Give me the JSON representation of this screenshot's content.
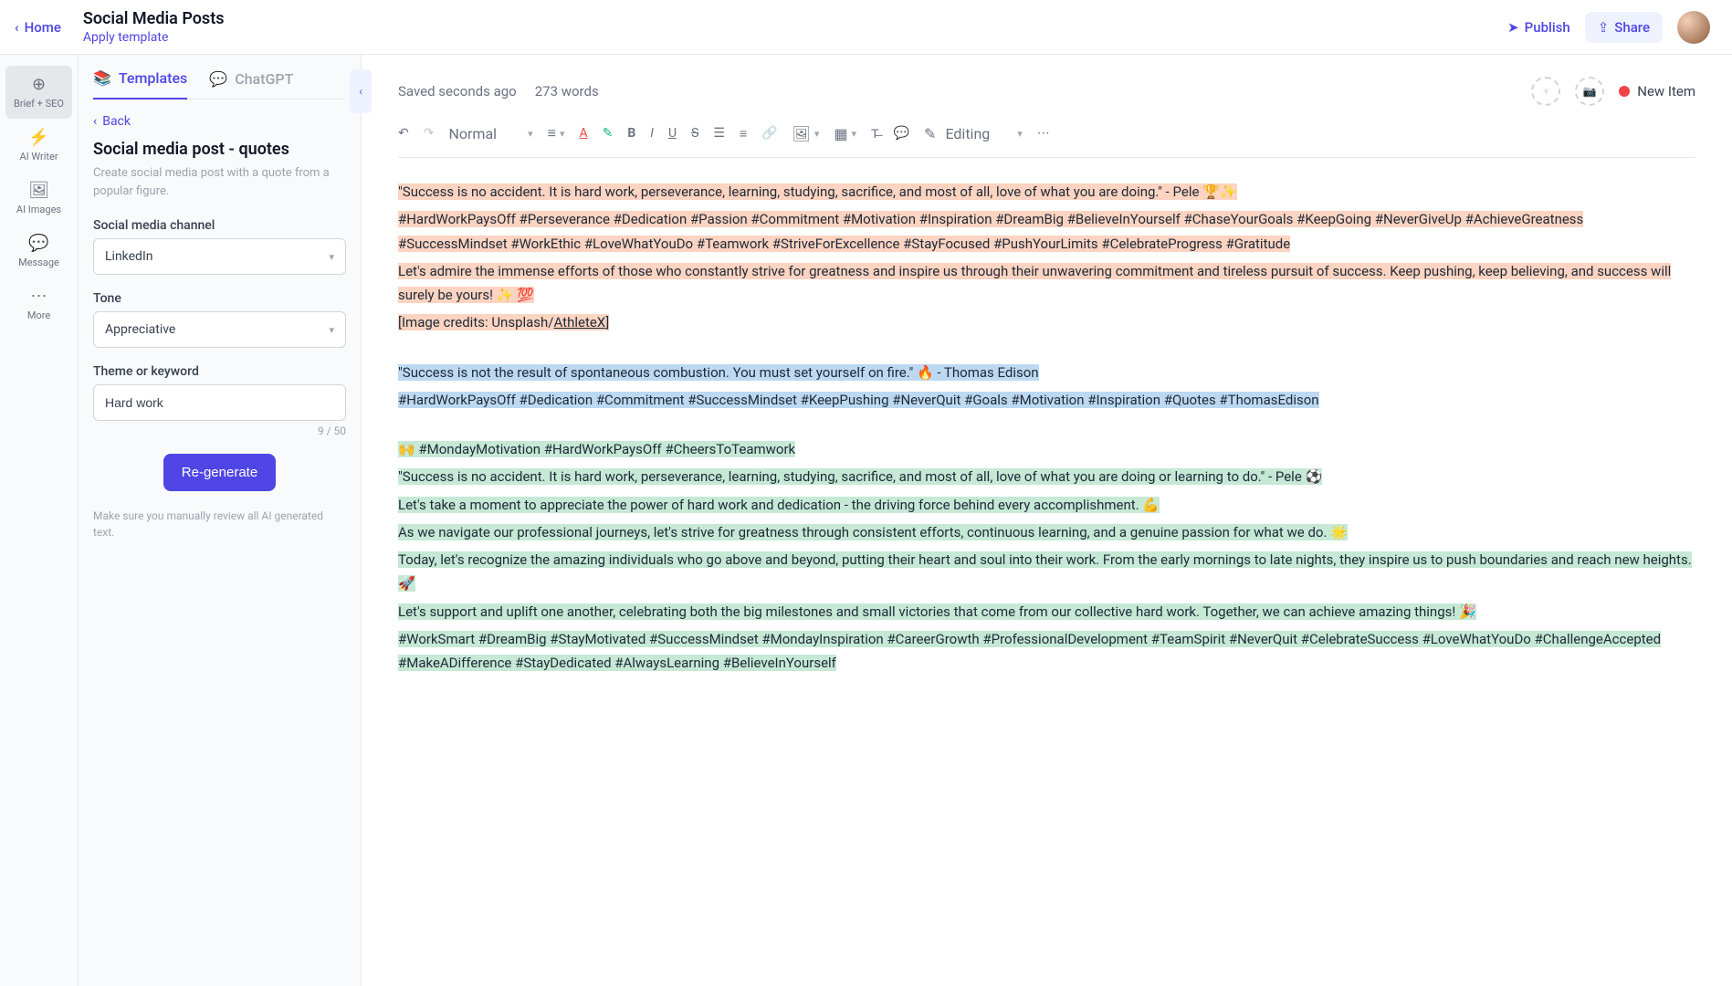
{
  "header": {
    "home": "Home",
    "title": "Social Media Posts",
    "apply_template": "Apply template",
    "publish": "Publish",
    "share": "Share"
  },
  "rail": {
    "brief": "Brief + SEO",
    "writer": "AI Writer",
    "images": "AI Images",
    "message": "Message",
    "more": "More"
  },
  "panel": {
    "tab_templates": "Templates",
    "tab_chatgpt": "ChatGPT",
    "back": "Back",
    "template_title": "Social media post - quotes",
    "template_desc": "Create social media post with a quote from a popular figure.",
    "channel_label": "Social media channel",
    "channel_value": "LinkedIn",
    "tone_label": "Tone",
    "tone_value": "Appreciative",
    "theme_label": "Theme or keyword",
    "theme_value": "Hard work",
    "char_count": "9 / 50",
    "regenerate": "Re-generate",
    "review_note": "Make sure you manually review all AI generated text."
  },
  "editor": {
    "saved": "Saved seconds ago",
    "word_count": "273 words",
    "new_item": "New Item",
    "format": "Normal",
    "editing": "Editing"
  },
  "content": {
    "o1": "\"Success is no accident. It is hard work, perseverance, learning, studying, sacrifice, and most of all, love of what you are doing.\" - Pele 🏆✨",
    "o2": "#HardWorkPaysOff #Perseverance #Dedication #Passion #Commitment #Motivation #Inspiration #DreamBig #BelieveInYourself #ChaseYourGoals #KeepGoing #NeverGiveUp #AchieveGreatness #SuccessMindset #WorkEthic #LoveWhatYouDo #Teamwork #StriveForExcellence #StayFocused #PushYourLimits #CelebrateProgress #Gratitude",
    "o3": "Let's admire the immense efforts of those who constantly strive for greatness and inspire us through their unwavering commitment and tireless pursuit of success. Keep pushing, keep believing, and success will surely be yours! ✨ 💯",
    "o4a": "[Image credits: Unsplash/",
    "o4b": "AthleteX",
    "o4c": "]",
    "b1": "\"Success is not the result of spontaneous combustion. You must set yourself on fire.\" 🔥 - Thomas Edison",
    "b2": "#HardWorkPaysOff #Dedication #Commitment #SuccessMindset #KeepPushing #NeverQuit #Goals #Motivation #Inspiration #Quotes #ThomasEdison",
    "g1": "🙌 #MondayMotivation #HardWorkPaysOff #CheersToTeamwork",
    "g2": "\"Success is no accident. It is hard work, perseverance, learning, studying, sacrifice, and most of all, love of what you are doing or learning to do.\" - Pele ⚽",
    "g3": "Let's take a moment to appreciate the power of hard work and dedication - the driving force behind every accomplishment. 💪",
    "g4": "As we navigate our professional journeys, let's strive for greatness through consistent efforts, continuous learning, and a genuine passion for what we do. 🌟",
    "g5": "Today, let's recognize the amazing individuals who go above and beyond, putting their heart and soul into their work. From the early mornings to late nights, they inspire us to push boundaries and reach new heights. 🚀",
    "g6": "Let's support and uplift one another, celebrating both the big milestones and small victories that come from our collective hard work. Together, we can achieve amazing things! 🎉",
    "g7": "#WorkSmart #DreamBig #StayMotivated #SuccessMindset #MondayInspiration #CareerGrowth #ProfessionalDevelopment #TeamSpirit #NeverQuit #CelebrateSuccess #LoveWhatYouDo #ChallengeAccepted #MakeADifference #StayDedicated #AlwaysLearning #BelieveInYourself"
  }
}
